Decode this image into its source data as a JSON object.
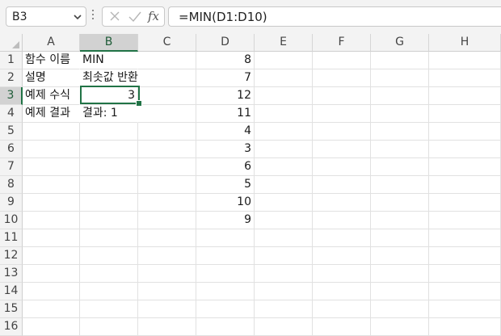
{
  "name_box": {
    "value": "B3"
  },
  "formula_bar": {
    "fx_label": "fx",
    "formula": "=MIN(D1:D10)"
  },
  "columns": [
    "A",
    "B",
    "C",
    "D",
    "E",
    "F",
    "G",
    "H"
  ],
  "rows": [
    "1",
    "2",
    "3",
    "4",
    "5",
    "6",
    "7",
    "8",
    "9",
    "10",
    "11",
    "12",
    "13",
    "14",
    "15",
    "16"
  ],
  "selected_cell": {
    "column": "B",
    "row": "3"
  },
  "cells": {
    "A1": "함수 이름",
    "B1": "MIN",
    "A2": "설명",
    "B2": "최솟값 반환",
    "A3": "예제 수식",
    "B3": "3",
    "A4": "예제 결과",
    "B4": "결과: 1",
    "D1": "8",
    "D2": "7",
    "D3": "12",
    "D4": "11",
    "D5": "4",
    "D6": "3",
    "D7": "6",
    "D8": "5",
    "D9": "10",
    "D10": "9"
  },
  "colors": {
    "accent": "#217346",
    "header_bg": "#f3f3f3",
    "header_selected_bg": "#d2d2d2"
  }
}
